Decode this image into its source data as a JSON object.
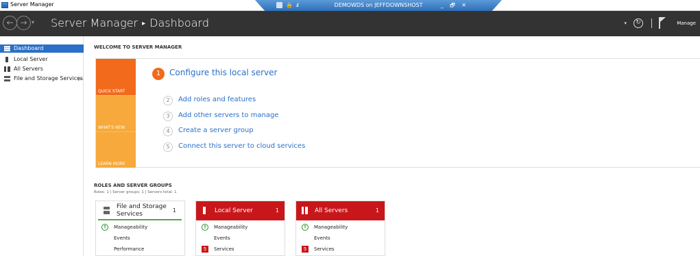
{
  "window": {
    "title": "Server Manager"
  },
  "remote_bar": {
    "host": "DEMOWDS on JEFFDOWNSHOST",
    "controls": [
      "_",
      "🗗",
      "✕"
    ]
  },
  "header": {
    "title": "Server Manager",
    "separator": "▸",
    "page": "Dashboard",
    "manage_label": "Manage"
  },
  "sidebar": {
    "items": [
      {
        "label": "Dashboard",
        "icon": "dashboard-icon",
        "active": true
      },
      {
        "label": "Local Server",
        "icon": "server-icon"
      },
      {
        "label": "All Servers",
        "icon": "servers-icon"
      },
      {
        "label": "File and Storage Services",
        "icon": "storage-icon",
        "has_submenu": true
      }
    ]
  },
  "welcome": {
    "heading": "WELCOME TO SERVER MANAGER",
    "tiles": [
      "QUICK START",
      "WHAT'S NEW",
      "LEARN MORE"
    ],
    "steps": [
      {
        "num": "1",
        "label": "Configure this local server"
      },
      {
        "num": "2",
        "label": "Add roles and features"
      },
      {
        "num": "3",
        "label": "Add other servers to manage"
      },
      {
        "num": "4",
        "label": "Create a server group"
      },
      {
        "num": "5",
        "label": "Connect this server to cloud services"
      }
    ]
  },
  "roles": {
    "heading": "ROLES AND SERVER GROUPS",
    "summary": "Roles: 1   |   Server groups: 1   |   Servers total: 1",
    "cards": [
      {
        "name": "File and Storage Services",
        "count": "1",
        "status": "ok",
        "rows": [
          {
            "label": "Manageability",
            "status": "ok"
          },
          {
            "label": "Events"
          },
          {
            "label": "Performance"
          }
        ]
      },
      {
        "name": "Local Server",
        "count": "1",
        "status": "alert",
        "rows": [
          {
            "label": "Manageability",
            "status": "ok"
          },
          {
            "label": "Events"
          },
          {
            "label": "Services",
            "badge": "5"
          }
        ]
      },
      {
        "name": "All Servers",
        "count": "1",
        "status": "alert",
        "rows": [
          {
            "label": "Manageability",
            "status": "ok"
          },
          {
            "label": "Events"
          },
          {
            "label": "Services",
            "badge": "5"
          }
        ]
      }
    ]
  },
  "colors": {
    "header_bg": "#333333",
    "accent_blue": "#2a70c8",
    "quick_start": "#f26a1b",
    "tile_amber": "#f7a93b",
    "alert_red": "#c8171b",
    "ok_green": "#2f8f2f"
  }
}
